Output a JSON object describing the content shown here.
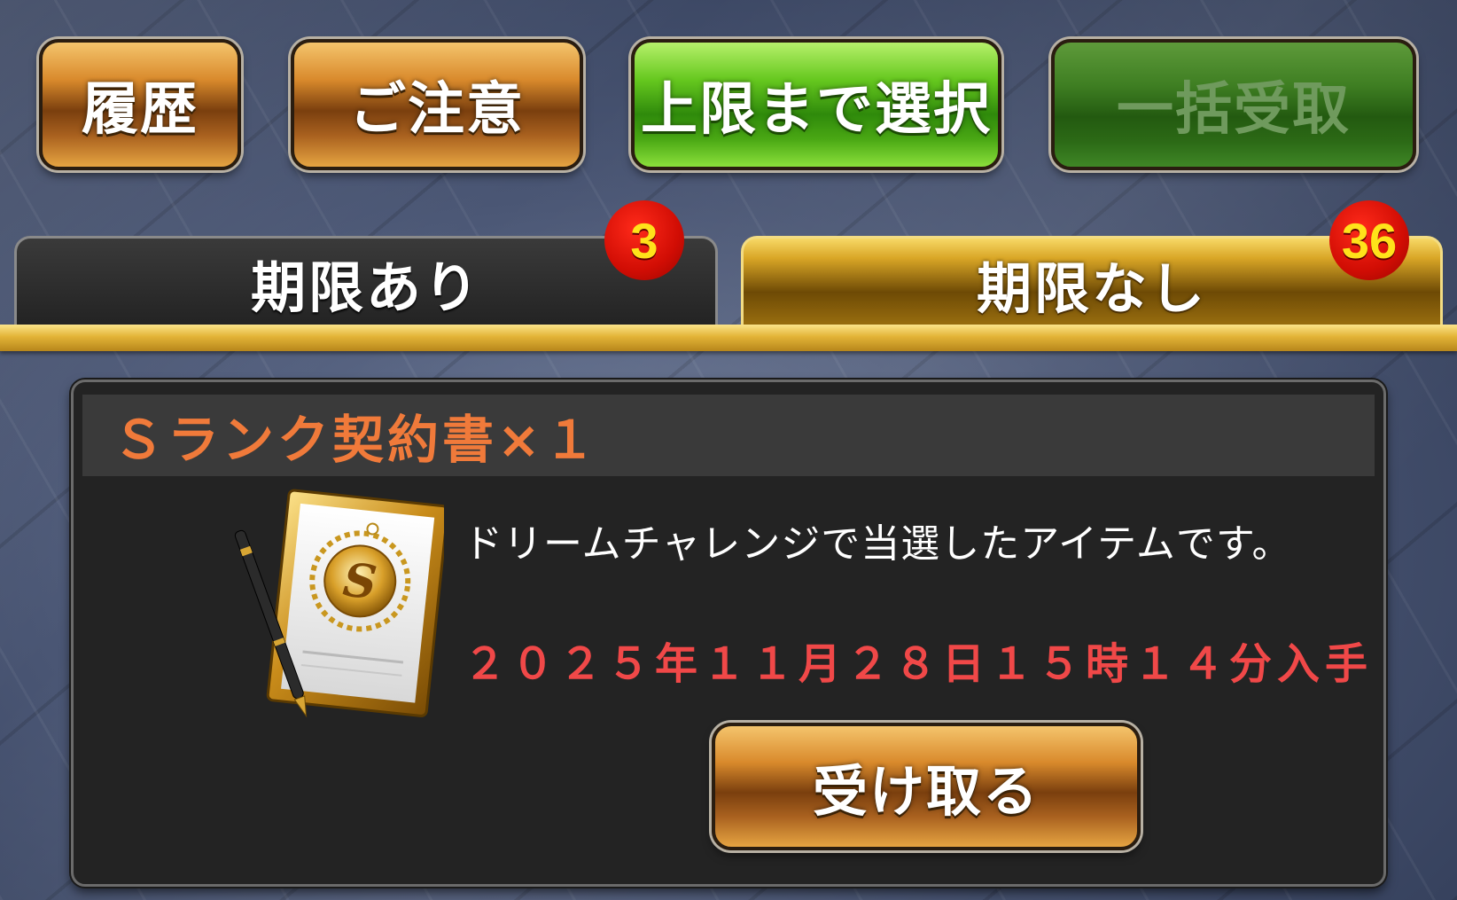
{
  "top_buttons": {
    "history_label": "履歴",
    "caution_label": "ご注意",
    "select_max_label": "上限まで選択",
    "bulk_receive_label": "一括受取"
  },
  "tabs": [
    {
      "label": "期限あり",
      "badge_count": "3",
      "selected": false
    },
    {
      "label": "期限なし",
      "badge_count": "36",
      "selected": true
    }
  ],
  "item": {
    "title": "Ｓランク契約書×１",
    "description": "ドリームチャレンジで当選したアイテムです。",
    "acquired_date": "２０２５年１１月２８日１５時１４分入手",
    "icon": "s-rank-contract-icon",
    "icon_letter": "S",
    "receive_label": "受け取る"
  },
  "colors": {
    "title_orange": "#f07a3a",
    "date_red": "#f04848",
    "badge_red": "#d10d04",
    "badge_text": "#ffe21a",
    "tab_gold": "#e3b437",
    "btn_green": "#4aa814"
  }
}
